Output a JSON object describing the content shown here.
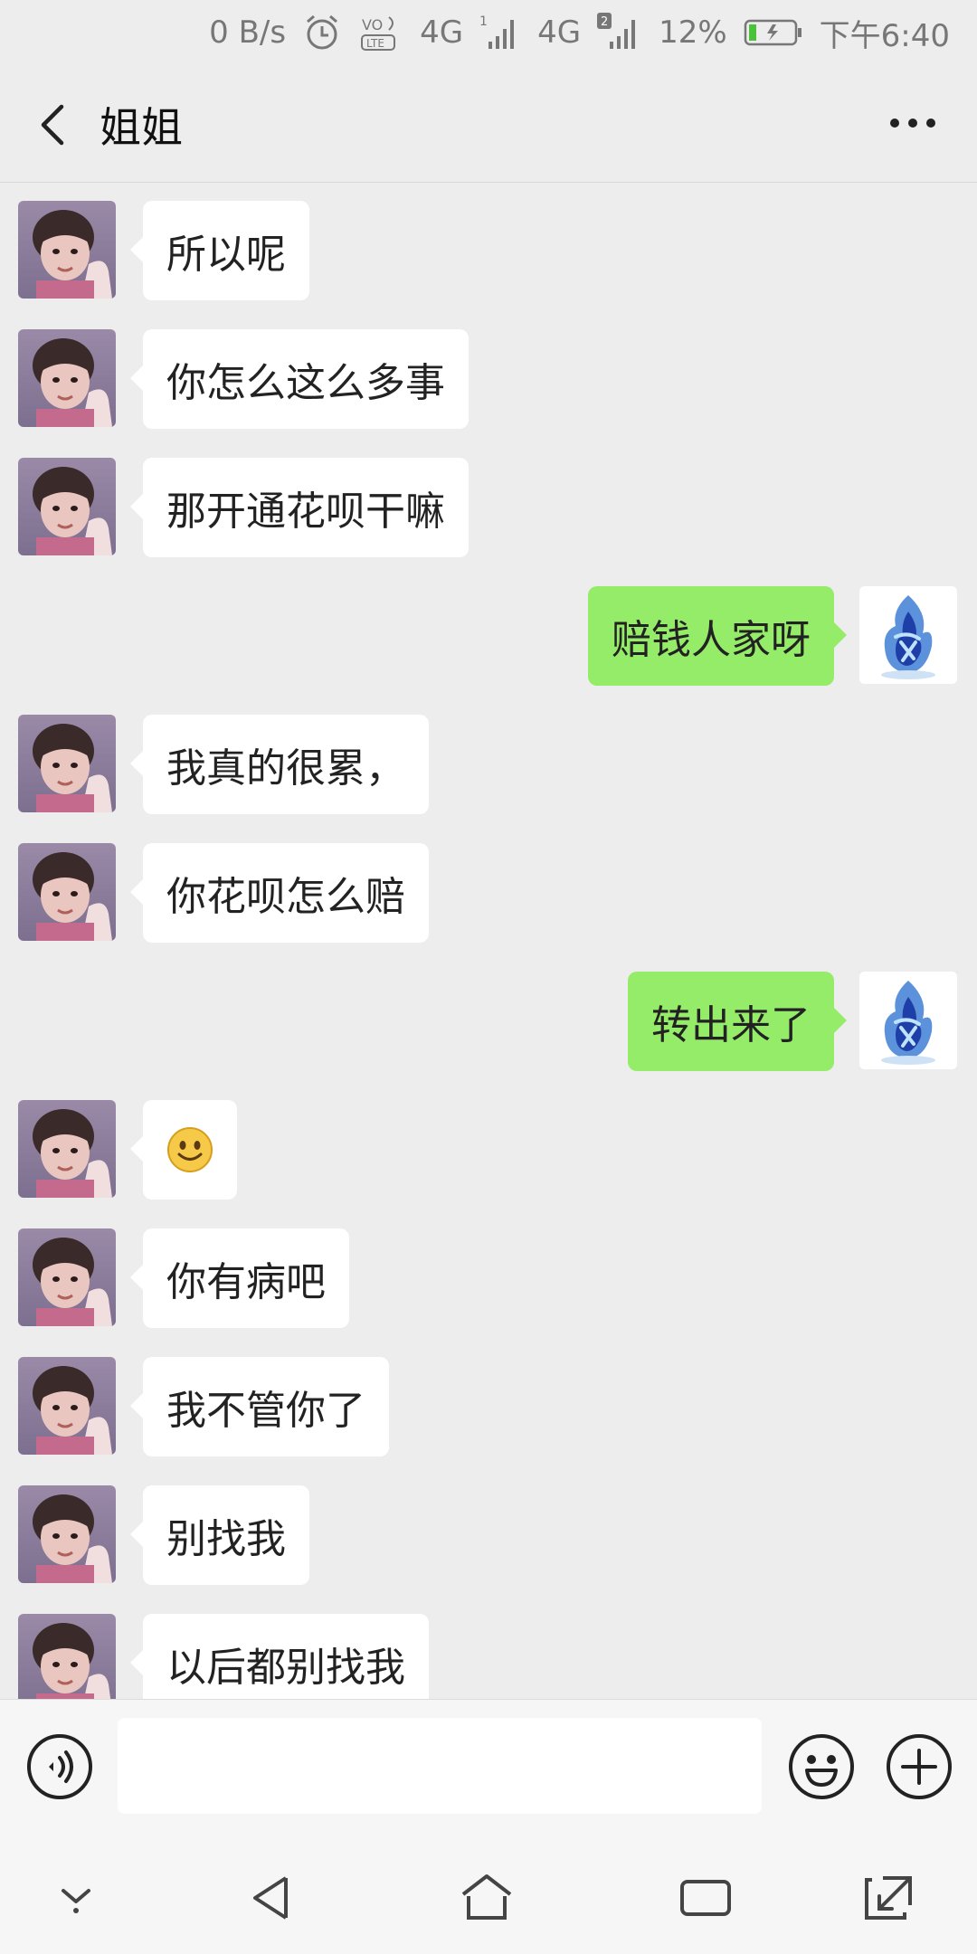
{
  "status_bar": {
    "net_speed": "0 B/s",
    "network_1": "4G",
    "sim_1": "1",
    "network_2": "4G",
    "sim_2": "2",
    "battery": "12%",
    "time": "下午6:40",
    "icons": [
      "alarm-icon",
      "volte-icon",
      "signal-icon",
      "battery-icon"
    ]
  },
  "nav": {
    "title": "姐姐",
    "icons": [
      "back-icon",
      "more-icon"
    ]
  },
  "messages": [
    {
      "side": "left",
      "text": "所以呢"
    },
    {
      "side": "left",
      "text": "你怎么这么多事"
    },
    {
      "side": "left",
      "text": "那开通花呗干嘛"
    },
    {
      "side": "right",
      "text": "赔钱人家呀"
    },
    {
      "side": "left",
      "text": "我真的很累，"
    },
    {
      "side": "left",
      "text": "你花呗怎么赔"
    },
    {
      "side": "right",
      "text": "转出来了"
    },
    {
      "side": "left",
      "text": "",
      "emoji": "smile-emoji"
    },
    {
      "side": "left",
      "text": "你有病吧"
    },
    {
      "side": "left",
      "text": "我不管你了"
    },
    {
      "side": "left",
      "text": "别找我"
    },
    {
      "side": "left",
      "text": "以后都别找我"
    }
  ],
  "input_bar": {
    "value": "",
    "icons": [
      "voice-icon",
      "emoji-icon",
      "plus-icon"
    ]
  },
  "system_nav": {
    "icons": [
      "hide-nav-icon",
      "back-triangle-icon",
      "home-icon",
      "recents-icon",
      "rotate-icon"
    ]
  },
  "colors": {
    "background": "#ededed",
    "incoming_bubble": "#ffffff",
    "outgoing_bubble": "#95ec69"
  }
}
